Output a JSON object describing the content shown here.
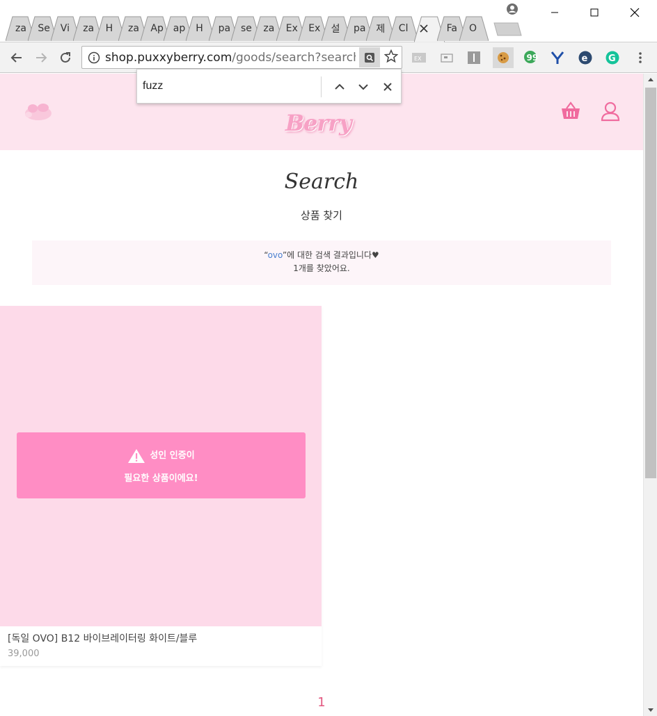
{
  "browser": {
    "tabs": [
      {
        "label": "za"
      },
      {
        "label": "Se"
      },
      {
        "label": "Vi"
      },
      {
        "label": "za"
      },
      {
        "label": "H"
      },
      {
        "label": "za"
      },
      {
        "label": "Ap"
      },
      {
        "label": "ap"
      },
      {
        "label": "H"
      },
      {
        "label": "pa"
      },
      {
        "label": "se"
      },
      {
        "label": "za"
      },
      {
        "label": "Ex"
      },
      {
        "label": "Ex"
      },
      {
        "label": "설"
      },
      {
        "label": "pa"
      },
      {
        "label": "제"
      },
      {
        "label": "Cl"
      },
      {
        "label": ""
      },
      {
        "label": "Fa"
      },
      {
        "label": "O"
      }
    ],
    "url_host": "shop.puxxyberry.com",
    "url_path": "/goods/search?search..."
  },
  "findbar": {
    "query": "fuzz"
  },
  "site": {
    "logo_text": "Berry"
  },
  "search": {
    "title": "Search",
    "subtitle": "상품 찾기",
    "result_quote_open": "“",
    "result_keyword": "ovo",
    "result_suffix": "”에 대한 검색 결과입니다♥",
    "result_count": "1개를 찾았어요."
  },
  "product": {
    "adult_line1": "성인 인증이",
    "adult_line2": "필요한 상품이에요!",
    "name": "[독일 OVO] B12 바이브레이터링 화이트/블루",
    "price": "39,000"
  },
  "pagination": {
    "current": "1"
  },
  "colors": {
    "header_bg": "#fde4ee",
    "product_bg": "#fddae9",
    "adult_banner": "#ff8dc4",
    "accent_pink": "#e2577f",
    "keyword_blue": "#4a7fd0"
  }
}
